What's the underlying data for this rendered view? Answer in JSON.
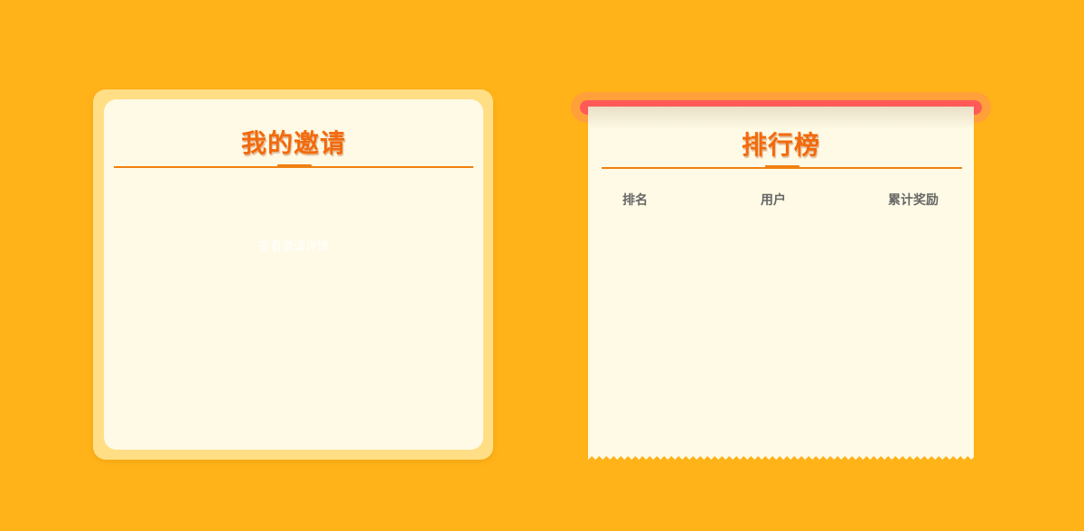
{
  "invite_panel": {
    "title": "我的邀请",
    "detail_link": "查看邀请详情"
  },
  "leaderboard_panel": {
    "title": "排行榜",
    "columns": [
      "排名",
      "用户",
      "累计奖励"
    ],
    "rows": []
  },
  "colors": {
    "page_background": "#FFB319",
    "card_frame": "#FFDE85",
    "card_surface": "#FFFAE5",
    "title_orange": "#F26A0D",
    "divider_orange": "#F08010",
    "scroll_roll_outer": "#FFA03A",
    "scroll_roll_inner": "#FF5A58",
    "header_text": "#666666"
  }
}
